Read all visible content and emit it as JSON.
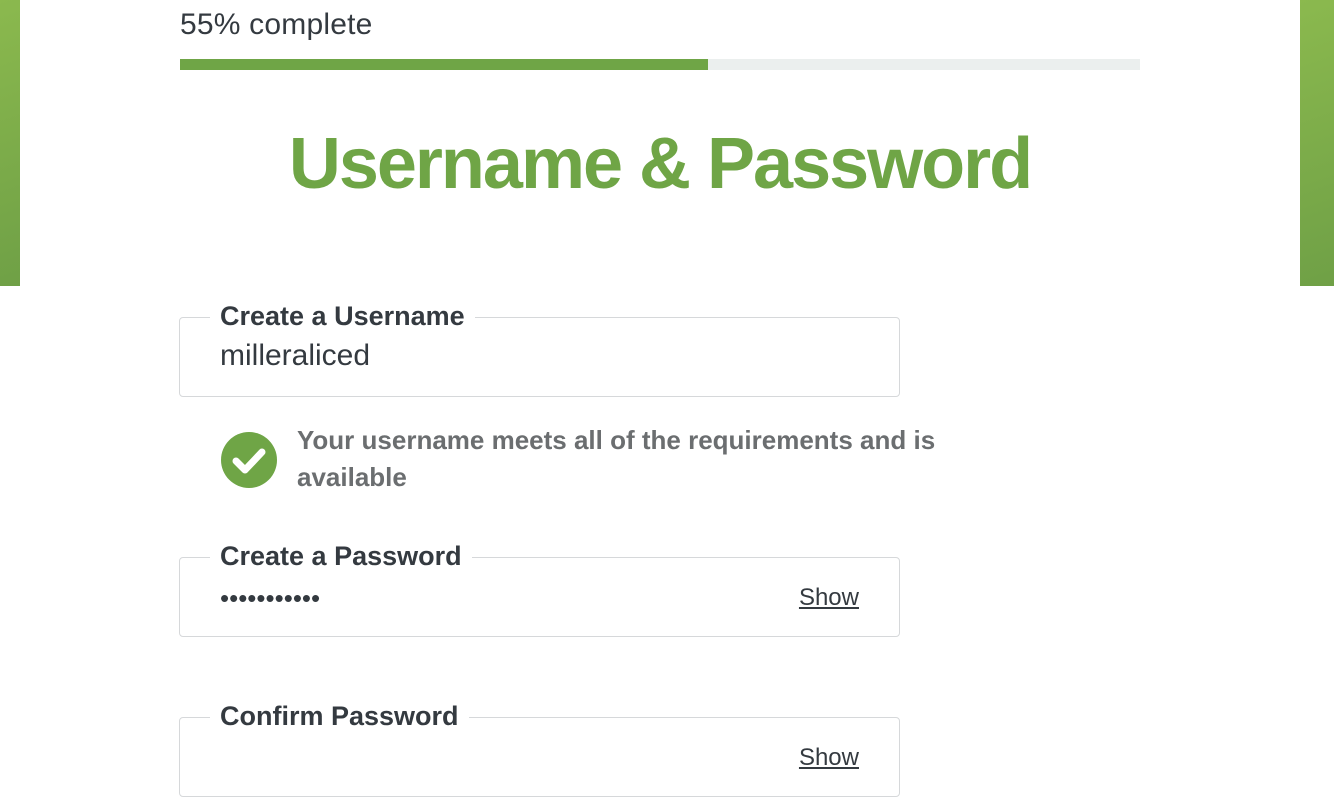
{
  "progress": {
    "label": "55% complete",
    "percent": 55
  },
  "title": "Username & Password",
  "username": {
    "legend": "Create a Username",
    "value": "milleraliced",
    "validation": {
      "icon": "check-circle-icon",
      "message": "Your username meets all of the requirements and is available"
    }
  },
  "password": {
    "legend": "Create a Password",
    "masked_value": "•••••••••••",
    "toggle_label": "Show"
  },
  "confirm_password": {
    "legend": "Confirm Password",
    "masked_value": "",
    "toggle_label": "Show"
  },
  "colors": {
    "accent": "#6fa546",
    "side_bar": "#7fae4a",
    "progress_track": "#ebefee",
    "text": "#343a40",
    "muted_text": "#6b6e70",
    "border": "#d6d8da"
  }
}
